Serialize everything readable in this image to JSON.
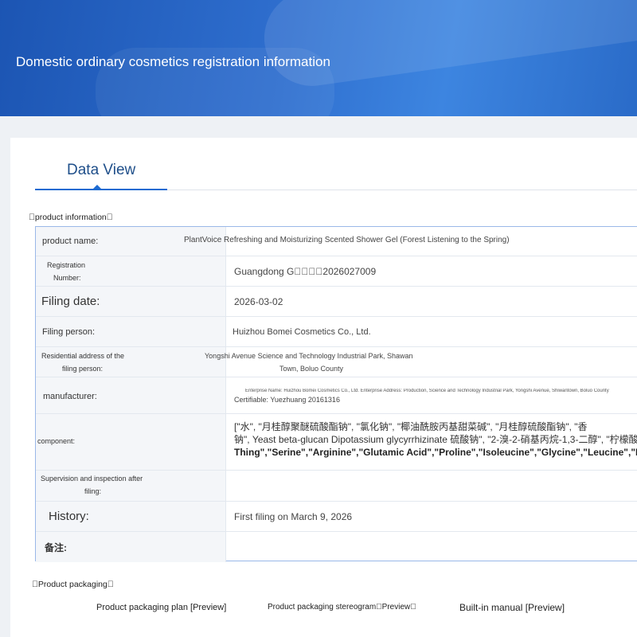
{
  "banner": {
    "title": "Domestic ordinary cosmetics registration information"
  },
  "tabs": {
    "active": "Data View"
  },
  "product_info": {
    "section_label": "\u0000product information\u0000",
    "rows": {
      "name": {
        "label": "product name:",
        "value": "PlantVoice Refreshing and Moisturizing Scented Shower Gel (Forest Listening to the Spring)"
      },
      "registration": {
        "label_line1": "Registration",
        "label_line2": "Number:",
        "value": "Guangdong G\u0000\u0000\u0000\u00002026027009"
      },
      "filing_date": {
        "label": "Filing date:",
        "value": "2026-03-02"
      },
      "filing_person": {
        "label": "Filing person:",
        "value": "Huizhou Bomei Cosmetics Co., Ltd."
      },
      "address": {
        "label_line1": "Residential address of the",
        "label_line2": "filing person:",
        "value_line1": "Yongshi Avenue Science and Technology Industrial Park, Shawan",
        "value_line2": "Town, Boluo County"
      },
      "manufacturer": {
        "label": "manufacturer:",
        "value_line1": "Enterprise Name: Huizhou Bomei Cosmetics Co., Ltd. Enterprise Address: Production, Science and Technology Industrial Park, Yongshi Avenue, Shiwantown, Boluo County",
        "value_line2": "Certifiable: Yuezhuang 20161316"
      },
      "component": {
        "label": "component:",
        "line1": "[\"水\", \"月桂醇聚醚硫酸酯钠\", \"氯化钠\", \"椰油酰胺丙基甜菜碱\", \"月桂醇硫酸酯钠\", \"香",
        "line2": "钠\", Yeast beta-glucan Dipotassium glycyrrhizinate 硫酸钠\", \"2-溴-2-硝基丙烷-1,3-二醇\", \"柠檬酸\"",
        "line3": "Thing\",\"Serine\",\"Arginine\",\"Glutamic Acid\",\"Proline\",\"Isoleucine\",\"Glycine\",\"Leucine\",\"Lysine\""
      },
      "supervision": {
        "label_line1": "Supervision and inspection after",
        "label_line2": "filing:",
        "value": ""
      },
      "history": {
        "label": "History:",
        "value": "First filing on March 9, 2026"
      },
      "remarks": {
        "label": "备注:",
        "value": ""
      }
    }
  },
  "packaging": {
    "section_label": "\u0000Product packaging\u0000",
    "items": [
      "Product packaging plan [Preview]",
      "Product packaging stereogram\u0000Preview\u0000",
      "Built-in manual [Preview]"
    ]
  }
}
